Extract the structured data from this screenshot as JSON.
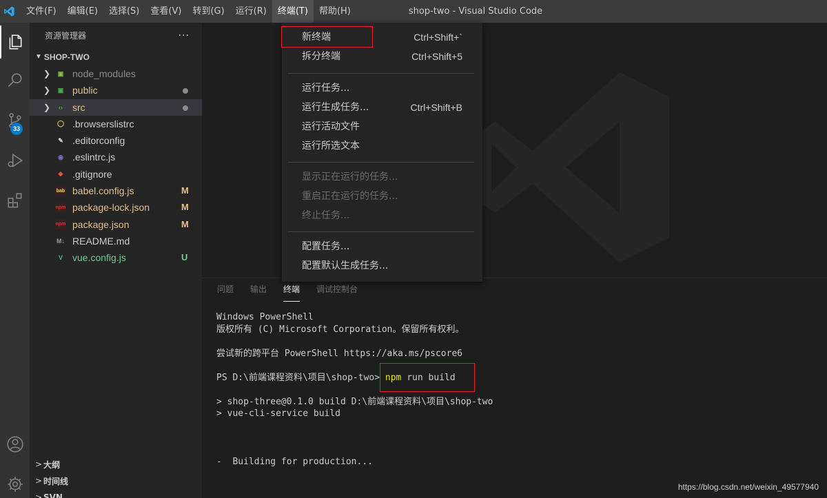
{
  "window": {
    "title": "shop-two - Visual Studio Code"
  },
  "menubar": {
    "items": [
      "文件(F)",
      "编辑(E)",
      "选择(S)",
      "查看(V)",
      "转到(G)",
      "运行(R)",
      "终端(T)",
      "帮助(H)"
    ],
    "active_index": 6
  },
  "activity": {
    "scm_badge": "33"
  },
  "sidebar": {
    "header": "资源管理器",
    "more": "···",
    "folder": "SHOP-TWO",
    "tree": [
      {
        "name": "node_modules",
        "icon": "node-modules-icon",
        "chevron": "›",
        "color": "#8c8c8c",
        "status": ""
      },
      {
        "name": "public",
        "icon": "public-folder-icon",
        "chevron": "›",
        "color": "#e2c08d",
        "status": "dot"
      },
      {
        "name": "src",
        "icon": "src-folder-icon",
        "chevron": "›",
        "color": "#e2c08d",
        "status": "dot"
      },
      {
        "name": ".browserslistrc",
        "icon": "browserslist-icon",
        "chevron": "",
        "color": "#cccccc",
        "status": ""
      },
      {
        "name": ".editorconfig",
        "icon": "editorconfig-icon",
        "chevron": "",
        "color": "#cccccc",
        "status": ""
      },
      {
        "name": ".eslintrc.js",
        "icon": "eslint-icon",
        "chevron": "",
        "color": "#cccccc",
        "status": ""
      },
      {
        "name": ".gitignore",
        "icon": "git-icon",
        "chevron": "",
        "color": "#cccccc",
        "status": ""
      },
      {
        "name": "babel.config.js",
        "icon": "babel-icon",
        "chevron": "",
        "color": "#e2c08d",
        "status": "M"
      },
      {
        "name": "package-lock.json",
        "icon": "npm-icon",
        "chevron": "",
        "color": "#e2c08d",
        "status": "M"
      },
      {
        "name": "package.json",
        "icon": "npm-icon",
        "chevron": "",
        "color": "#e2c08d",
        "status": "M"
      },
      {
        "name": "README.md",
        "icon": "markdown-icon",
        "chevron": "",
        "color": "#cccccc",
        "status": ""
      },
      {
        "name": "vue.config.js",
        "icon": "vue-icon",
        "chevron": "",
        "color": "#73c991",
        "status": "U"
      }
    ],
    "sections": [
      "大纲",
      "时间线",
      "SVN"
    ]
  },
  "terminal_menu": {
    "items": [
      {
        "label": "新终端",
        "key": "Ctrl+Shift+`",
        "disabled": false
      },
      {
        "label": "拆分终端",
        "key": "Ctrl+Shift+5",
        "disabled": false
      },
      {
        "label": "运行任务...",
        "key": "",
        "disabled": false
      },
      {
        "label": "运行生成任务...",
        "key": "Ctrl+Shift+B",
        "disabled": false
      },
      {
        "label": "运行活动文件",
        "key": "",
        "disabled": false
      },
      {
        "label": "运行所选文本",
        "key": "",
        "disabled": false
      },
      {
        "label": "显示正在运行的任务...",
        "key": "",
        "disabled": true
      },
      {
        "label": "重启正在运行的任务...",
        "key": "",
        "disabled": true
      },
      {
        "label": "终止任务...",
        "key": "",
        "disabled": true
      },
      {
        "label": "配置任务...",
        "key": "",
        "disabled": false
      },
      {
        "label": "配置默认生成任务...",
        "key": "",
        "disabled": false
      }
    ]
  },
  "panel": {
    "tabs": [
      "问题",
      "输出",
      "终端",
      "调试控制台"
    ],
    "active_tab": 2,
    "terminal_lines": [
      "Windows PowerShell",
      "版权所有 (C) Microsoft Corporation。保留所有权利。",
      "",
      "尝试新的跨平台 PowerShell https://aka.ms/pscore6",
      "",
      "PS D:\\前端课程资料\\项目\\shop-two> ",
      "",
      "> shop-three@0.1.0 build D:\\前端课程资料\\项目\\shop-two",
      "> vue-cli-service build",
      "",
      "",
      "",
      "-  Building for production..."
    ],
    "command_npm": "npm",
    "command_rest": " run build"
  },
  "watermark": "https://blog.csdn.net/weixin_49577940",
  "colors": {
    "accent": "#007acc",
    "highlight_box": "#e0262b",
    "modified": "#e2c08d",
    "untracked": "#73c991"
  }
}
